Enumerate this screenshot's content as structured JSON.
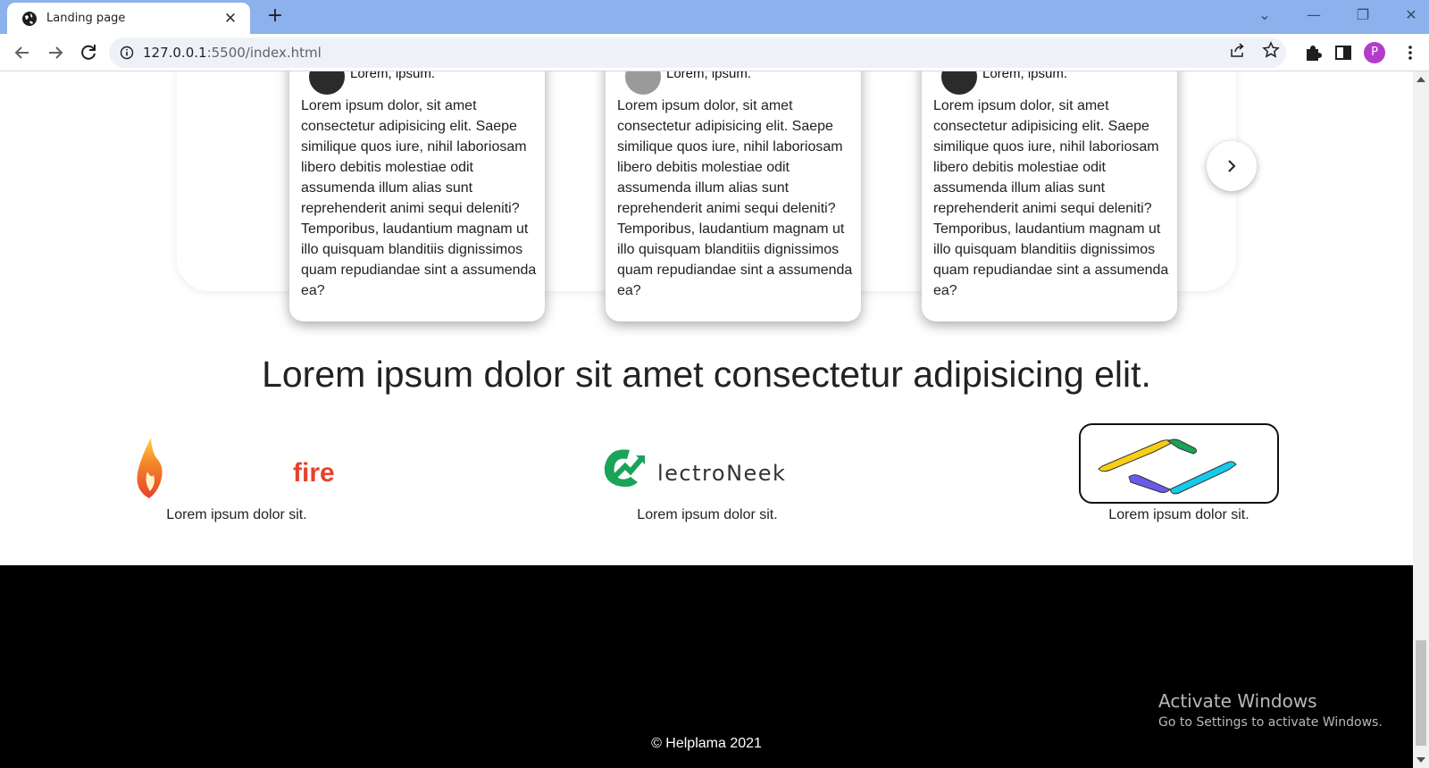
{
  "browser": {
    "tab_title": "Landing page",
    "tab_close": "✕",
    "new_tab": "+",
    "url_host": "127.0.0.1",
    "url_rest": ":5500/index.html",
    "profile_initial": "P",
    "window_controls": {
      "dropdown": "⌄",
      "minimize": "—",
      "restore": "❐",
      "close": "✕"
    }
  },
  "testimonials": {
    "cards": [
      {
        "name": "Lorem, ipsum.",
        "text": "Lorem ipsum dolor, sit amet consectetur adipisicing elit. Saepe similique quos iure, nihil laboriosam libero debitis molestiae odit assumenda illum alias sunt reprehenderit animi sequi deleniti? Temporibus, laudantium magnam ut illo quisquam blanditiis dignissimos quam repudiandae sint a assumenda ea?"
      },
      {
        "name": "Lorem, ipsum.",
        "text": "Lorem ipsum dolor, sit amet consectetur adipisicing elit. Saepe similique quos iure, nihil laboriosam libero debitis molestiae odit assumenda illum alias sunt reprehenderit animi sequi deleniti? Temporibus, laudantium magnam ut illo quisquam blanditiis dignissimos quam repudiandae sint a assumenda ea?"
      },
      {
        "name": "Lorem, ipsum.",
        "text": "Lorem ipsum dolor, sit amet consectetur adipisicing elit. Saepe similique quos iure, nihil laboriosam libero debitis molestiae odit assumenda illum alias sunt reprehenderit animi sequi deleniti? Temporibus, laudantium magnam ut illo quisquam blanditiis dignissimos quam repudiandae sint a assumenda ea?"
      }
    ],
    "next_icon": "chevron-right-icon"
  },
  "partners": {
    "headline": "Lorem ipsum dolor sit amet consectetur adipisicing elit.",
    "brands": [
      {
        "logo_text": "fire",
        "caption": "Lorem ipsum dolor sit."
      },
      {
        "logo_text": "lectroNeek",
        "caption": "Lorem ipsum dolor sit."
      },
      {
        "logo_text": "",
        "caption": "Lorem ipsum dolor sit."
      }
    ]
  },
  "footer": {
    "copyright": "© Helplama 2021"
  },
  "windows_watermark": {
    "line1": "Activate Windows",
    "line2": "Go to Settings to activate Windows."
  },
  "colors": {
    "tabbar": "#8cb1ec",
    "footer_bg": "#000000",
    "fire_text": "#e8412c",
    "electroneek_green": "#1aa359",
    "profile": "#b43bcb"
  }
}
